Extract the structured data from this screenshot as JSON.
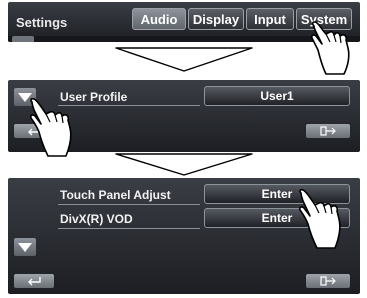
{
  "step1": {
    "title": "Settings",
    "tabs": [
      "Audio",
      "Display",
      "Input",
      "System"
    ]
  },
  "step2": {
    "row_label": "User Profile",
    "value": "User1"
  },
  "step3": {
    "rows": [
      {
        "label": "Touch Panel Adjust",
        "button": "Enter"
      },
      {
        "label": "DivX(R) VOD",
        "button": "Enter"
      }
    ]
  },
  "icons": {
    "pointer": "hand-pointer-icon",
    "back": "back-arrow-icon",
    "exit": "exit-icon",
    "down": "down-triangle-icon",
    "flow": "down-arrow-icon"
  },
  "colors": {
    "panel_top": "#3a3d44",
    "panel_bottom": "#1c1e23",
    "button_border": "#8d939b",
    "text": "#ffffff"
  }
}
